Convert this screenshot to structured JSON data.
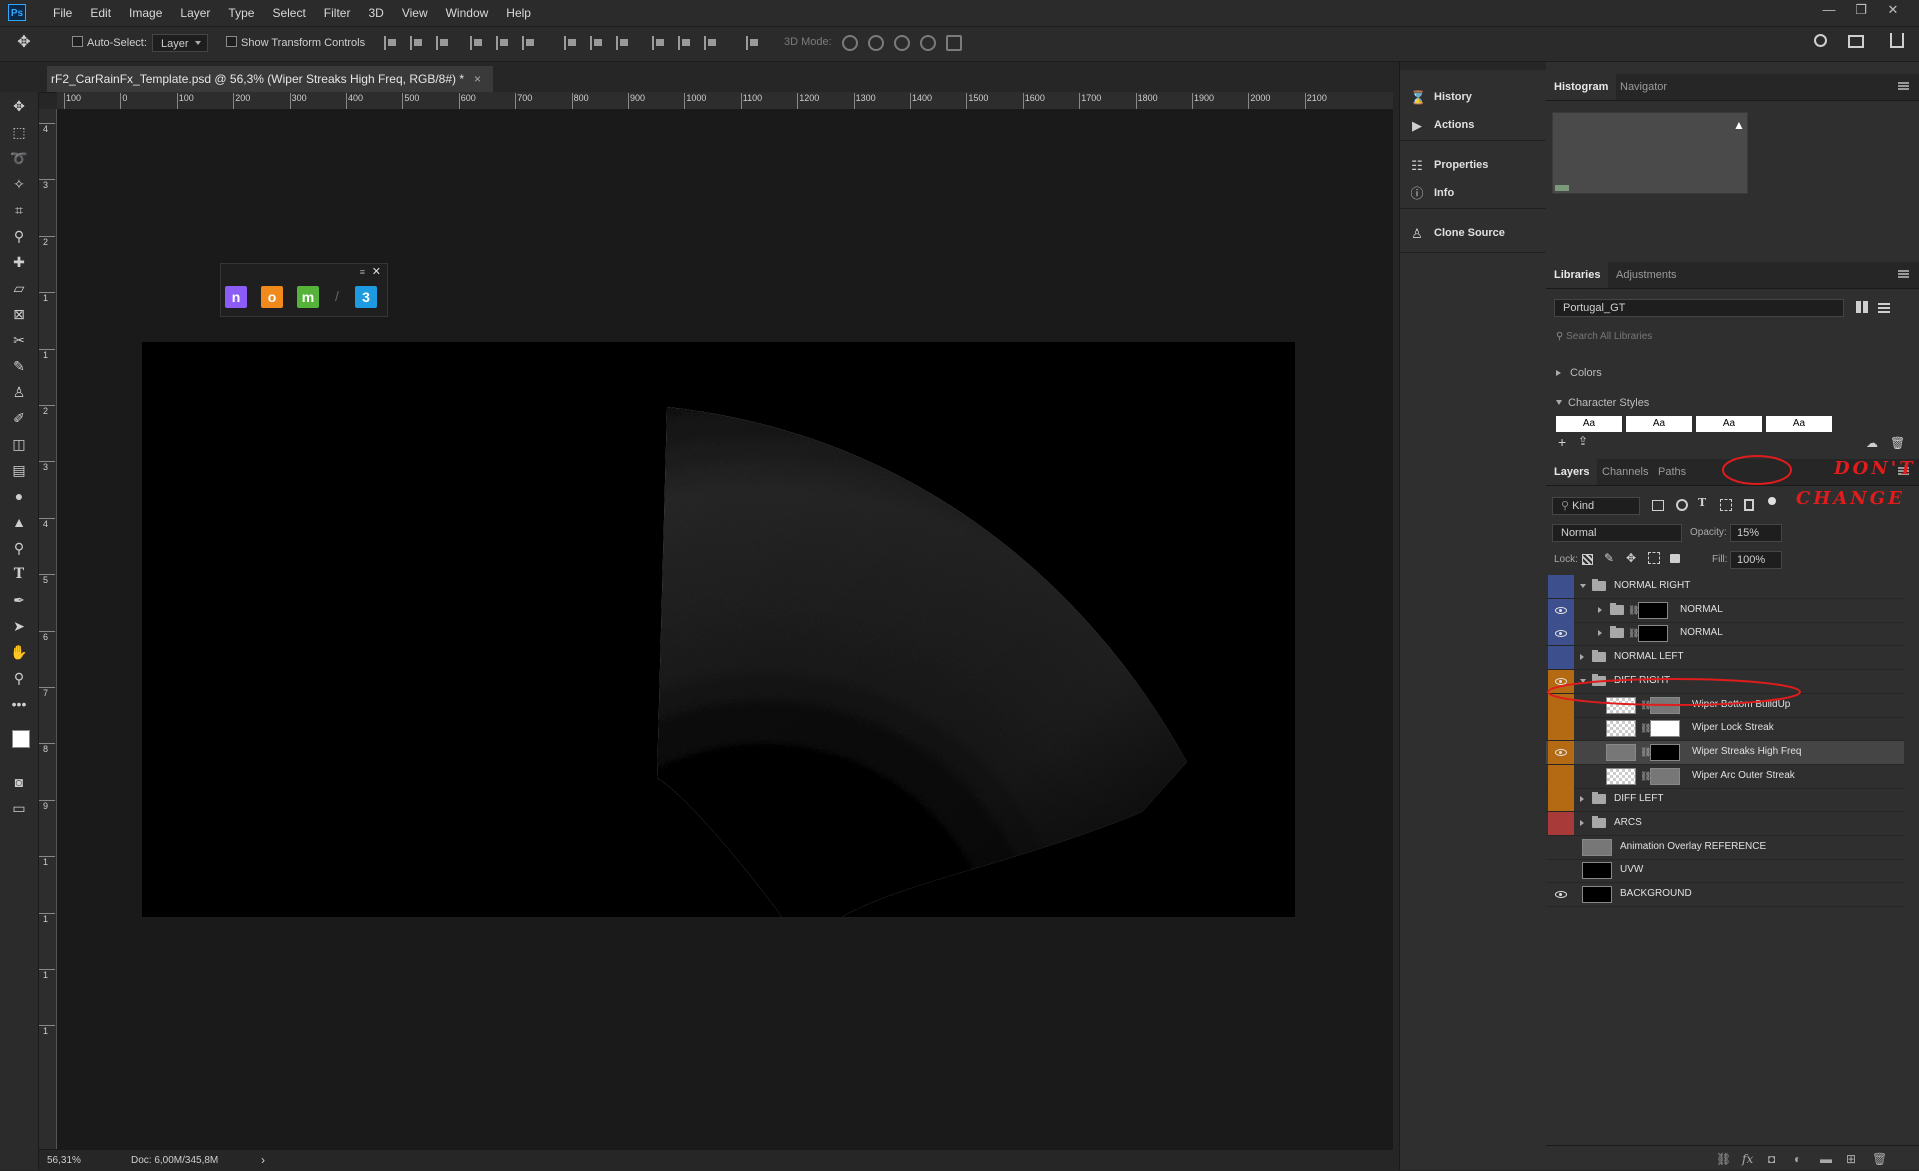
{
  "app": {
    "logo": "Ps"
  },
  "menu": [
    "File",
    "Edit",
    "Image",
    "Layer",
    "Type",
    "Select",
    "Filter",
    "3D",
    "View",
    "Window",
    "Help"
  ],
  "window_controls": [
    "—",
    "❐",
    "✕"
  ],
  "options_bar": {
    "auto_select_label": "Auto-Select:",
    "auto_select_target": "Layer",
    "show_transform_label": "Show Transform Controls",
    "mode_3d_label": "3D Mode:"
  },
  "document": {
    "tab_title": "rF2_CarRainFx_Template.psd @ 56,3% (Wiper Streaks High Freq, RGB/8#) *",
    "close": "×",
    "ruler_h": [
      "100",
      "0",
      "100",
      "200",
      "300",
      "400",
      "500",
      "600",
      "700",
      "800",
      "900",
      "1000",
      "1100",
      "1200",
      "1300",
      "1400",
      "1500",
      "1600",
      "1700",
      "1800",
      "1900",
      "2000",
      "2100"
    ],
    "ruler_v": [
      "4",
      "3",
      "2",
      "1",
      "1",
      "2",
      "3",
      "4",
      "5",
      "6",
      "7",
      "8",
      "9",
      "1",
      "1",
      "1",
      "1"
    ]
  },
  "mini_palette": {
    "icons": [
      {
        "letter": "n",
        "color": "#8b5cf6"
      },
      {
        "letter": "o",
        "color": "#f08a1c"
      },
      {
        "letter": "m",
        "color": "#56b33a"
      },
      {
        "letter": "3",
        "color": "#1e9be0"
      }
    ]
  },
  "status": {
    "zoom": "56,31%",
    "doc": "Doc: 6,00M/345,8M",
    "arrow": "›"
  },
  "dock": {
    "items": [
      {
        "label": "History",
        "icon": "history-icon",
        "glyph": "⌛"
      },
      {
        "label": "Actions",
        "icon": "play-icon",
        "glyph": "▶"
      },
      {
        "label": "Properties",
        "icon": "properties-icon",
        "glyph": "☷"
      },
      {
        "label": "Info",
        "icon": "info-icon",
        "glyph": "ⓘ"
      },
      {
        "label": "Clone Source",
        "icon": "clone-stamp-icon",
        "glyph": "♙"
      }
    ]
  },
  "histogram_panel": {
    "tabs": [
      "Histogram",
      "Navigator"
    ]
  },
  "libraries_panel": {
    "tabs": [
      "Libraries",
      "Adjustments"
    ],
    "library": "Portugal_GT",
    "search_placeholder": "Search All Libraries",
    "sections": [
      "Colors",
      "Character Styles"
    ],
    "char_styles": [
      "Aa",
      "Aa",
      "Aa",
      "Aa"
    ]
  },
  "layers_panel": {
    "tabs": [
      "Layers",
      "Channels",
      "Paths"
    ],
    "kind": "Kind",
    "blend_mode": "Normal",
    "opacity_label": "Opacity:",
    "opacity": "15%",
    "lock_label": "Lock:",
    "fill_label": "Fill:",
    "fill": "100%",
    "layers": [
      {
        "name": "NORMAL RIGHT",
        "type": "group",
        "indent": 0,
        "expanded": true,
        "visible": false,
        "color": "#3d4f8c"
      },
      {
        "name": "NORMAL",
        "type": "group-mask",
        "indent": 1,
        "expanded": false,
        "visible": true,
        "color": "#3d4f8c"
      },
      {
        "name": "NORMAL",
        "type": "group-mask",
        "indent": 1,
        "expanded": false,
        "visible": true,
        "color": "#3d4f8c"
      },
      {
        "name": "NORMAL LEFT",
        "type": "group",
        "indent": 0,
        "expanded": false,
        "visible": false,
        "color": "#3d4f8c"
      },
      {
        "name": "DIFF RIGHT",
        "type": "group",
        "indent": 0,
        "expanded": true,
        "visible": true,
        "color": "#b36a12"
      },
      {
        "name": "Wiper Bottom BuildUp",
        "type": "masked",
        "indent": 1,
        "visible": false,
        "color": "#b36a12"
      },
      {
        "name": "Wiper Lock Streak",
        "type": "masked",
        "indent": 1,
        "visible": false,
        "color": "#b36a12"
      },
      {
        "name": "Wiper Streaks High Freq",
        "type": "masked",
        "indent": 1,
        "visible": true,
        "color": "#b36a12",
        "selected": true
      },
      {
        "name": "Wiper Arc Outer Streak",
        "type": "masked",
        "indent": 1,
        "visible": false,
        "color": "#b36a12"
      },
      {
        "name": "DIFF LEFT",
        "type": "group",
        "indent": 0,
        "expanded": false,
        "visible": false,
        "color": "#b36a12"
      },
      {
        "name": "ARCS",
        "type": "group",
        "indent": 0,
        "expanded": false,
        "visible": false,
        "color": "#a83a3a"
      },
      {
        "name": "Animation Overlay REFERENCE",
        "type": "pixel",
        "indent": 0,
        "visible": false,
        "color": ""
      },
      {
        "name": "UVW",
        "type": "pixel",
        "indent": 0,
        "visible": false,
        "color": ""
      },
      {
        "name": "BACKGROUND",
        "type": "pixel",
        "indent": 0,
        "visible": true,
        "color": ""
      }
    ]
  },
  "annotation": {
    "line1": "DON'T",
    "line2": "CHANGE",
    "color": "#e01c1c"
  }
}
